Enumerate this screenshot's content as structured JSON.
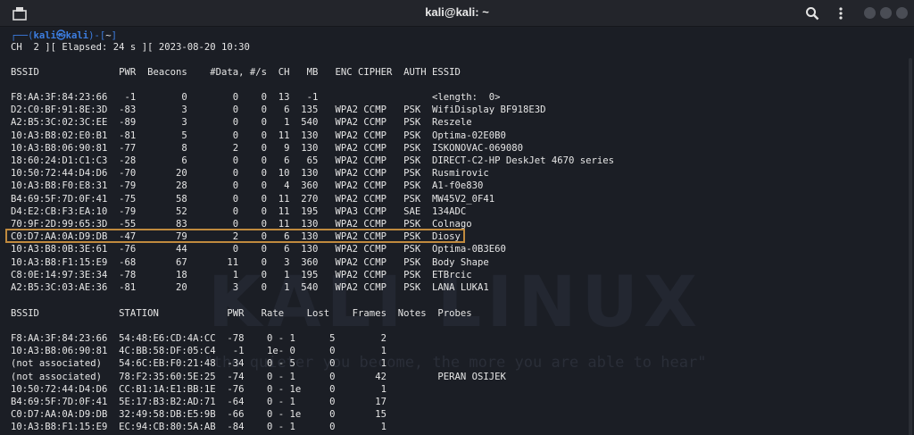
{
  "window": {
    "title": "kali@kali: ~",
    "icons": [
      "new-tab-icon",
      "search-icon",
      "kebab-menu-icon",
      "minimize-icon",
      "maximize-icon",
      "close-icon"
    ]
  },
  "prompt": {
    "user": "kali",
    "host": "kali",
    "at_symbol": "㉿",
    "dir": "~",
    "line1_open": "┌──(",
    "line1_mid": ")-[",
    "line1_close": "]"
  },
  "status_line": "CH  2 ][ Elapsed: 24 s ][ 2023-08-20 10:30",
  "ap_header": "BSSID              PWR  Beacons    #Data, #/s  CH   MB   ENC CIPHER  AUTH ESSID",
  "ap_rows": [
    "F8:AA:3F:84:23:66   -1        0        0    0  13   -1                    <length:  0>",
    "D2:C0:BF:91:8E:3D  -83        3        0    0   6  135   WPA2 CCMP   PSK  WifiDisplay BF918E3D",
    "A2:B5:3C:02:3C:EE  -89        3        0    0   1  540   WPA2 CCMP   PSK  Reszele",
    "10:A3:B8:02:E0:B1  -81        5        0    0  11  130   WPA2 CCMP   PSK  Optima-02E0B0",
    "10:A3:B8:06:90:81  -77        8        2    0   9  130   WPA2 CCMP   PSK  ISKONOVAC-069080",
    "18:60:24:D1:C1:C3  -28        6        0    0   6   65   WPA2 CCMP   PSK  DIRECT-C2-HP DeskJet 4670 series",
    "10:50:72:44:D4:D6  -70       20        0    0  10  130   WPA2 CCMP   PSK  Rusmirovic",
    "10:A3:B8:F0:E8:31  -79       28        0    0   4  360   WPA2 CCMP   PSK  A1-f0e830",
    "B4:69:5F:7D:0F:41  -75       58        0    0  11  270   WPA2 CCMP   PSK  MW45V2_0F41",
    "D4:E2:CB:F3:EA:10  -79       52        0    0  11  195   WPA3 CCMP   SAE  134ADC",
    "70:9F:2D:99:65:3D  -55       83        0    0  11  130   WPA2 CCMP   PSK  Colnago",
    "C0:D7:AA:0A:D9:DB  -47       79        2    0   6  130   WPA2 CCMP   PSK  Diosy",
    "10:A3:B8:0B:3E:61  -76       44        0    0   6  130   WPA2 CCMP   PSK  Optima-0B3E60",
    "10:A3:B8:F1:15:E9  -68       67       11    0   3  360   WPA2 CCMP   PSK  Body Shape",
    "C8:0E:14:97:3E:34  -78       18        1    0   1  195   WPA2 CCMP   PSK  ETBrcic",
    "A2:B5:3C:03:AE:36  -81       20        3    0   1  540   WPA2 CCMP   PSK  LANA LUKA1"
  ],
  "station_header": "BSSID              STATION            PWR   Rate    Lost    Frames  Notes  Probes",
  "station_rows": [
    "F8:AA:3F:84:23:66  54:48:E6:CD:4A:CC  -78    0 - 1      5        2",
    "10:A3:B8:06:90:81  4C:BB:58:DF:05:C4   -1    1e- 0      0        1",
    "(not associated)   54:6C:EB:F0:21:48  -34    0 - 5      0        1",
    "(not associated)   78:F2:35:60:5E:25  -74    0 - 1      0       42         PERAN OSIJEK",
    "10:50:72:44:D4:D6  CC:B1:1A:E1:BB:1E  -76    0 - 1e     0        1",
    "B4:69:5F:7D:0F:41  5E:17:B3:B2:AD:71  -64    0 - 1      0       17",
    "C0:D7:AA:0A:D9:DB  32:49:58:DB:E5:9B  -66    0 - 1e     0       15",
    "10:A3:B8:F1:15:E9  EC:94:CB:80:5A:AB  -84    0 - 1      0        1"
  ],
  "watermark": {
    "logo_text": "KALI LINUX",
    "tagline": "\"the quieter you become, the more you are able to hear\""
  },
  "highlight_color": "#c08a3e"
}
